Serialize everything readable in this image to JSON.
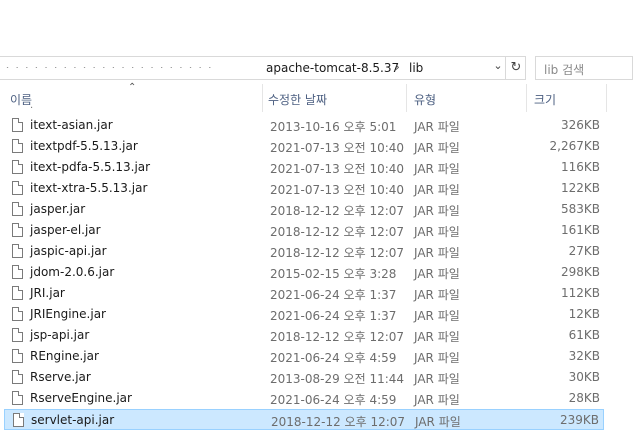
{
  "address_bar": {
    "breadcrumbs": [
      "apache-tomcat-8.5.37",
      "lib"
    ],
    "separator": "›"
  },
  "search": {
    "placeholder": "lib 검색"
  },
  "columns": {
    "name": "이름",
    "modified": "수정한 날짜",
    "type": "유형",
    "size": "크기"
  },
  "files": [
    {
      "name": "itext-asian.jar",
      "modified": "2013-10-16 오후 5:01",
      "type": "JAR 파일",
      "size": "326KB"
    },
    {
      "name": "itextpdf-5.5.13.jar",
      "modified": "2021-07-13 오전 10:40",
      "type": "JAR 파일",
      "size": "2,267KB"
    },
    {
      "name": "itext-pdfa-5.5.13.jar",
      "modified": "2021-07-13 오전 10:40",
      "type": "JAR 파일",
      "size": "116KB"
    },
    {
      "name": "itext-xtra-5.5.13.jar",
      "modified": "2021-07-13 오전 10:40",
      "type": "JAR 파일",
      "size": "122KB"
    },
    {
      "name": "jasper.jar",
      "modified": "2018-12-12 오후 12:07",
      "type": "JAR 파일",
      "size": "583KB"
    },
    {
      "name": "jasper-el.jar",
      "modified": "2018-12-12 오후 12:07",
      "type": "JAR 파일",
      "size": "161KB"
    },
    {
      "name": "jaspic-api.jar",
      "modified": "2018-12-12 오후 12:07",
      "type": "JAR 파일",
      "size": "27KB"
    },
    {
      "name": "jdom-2.0.6.jar",
      "modified": "2015-02-15 오후 3:28",
      "type": "JAR 파일",
      "size": "298KB"
    },
    {
      "name": "JRI.jar",
      "modified": "2021-06-24 오후 1:37",
      "type": "JAR 파일",
      "size": "112KB"
    },
    {
      "name": "JRIEngine.jar",
      "modified": "2021-06-24 오후 1:37",
      "type": "JAR 파일",
      "size": "12KB"
    },
    {
      "name": "jsp-api.jar",
      "modified": "2018-12-12 오후 12:07",
      "type": "JAR 파일",
      "size": "61KB"
    },
    {
      "name": "REngine.jar",
      "modified": "2021-06-24 오후 4:59",
      "type": "JAR 파일",
      "size": "32KB"
    },
    {
      "name": "Rserve.jar",
      "modified": "2013-08-29 오전 11:44",
      "type": "JAR 파일",
      "size": "30KB"
    },
    {
      "name": "RserveEngine.jar",
      "modified": "2021-06-24 오후 4:59",
      "type": "JAR 파일",
      "size": "28KB"
    },
    {
      "name": "servlet-api.jar",
      "modified": "2018-12-12 오후 12:07",
      "type": "JAR 파일",
      "size": "239KB",
      "selected": true
    }
  ],
  "colors": {
    "selected_bg": "#cce8ff",
    "selected_border": "#99d1ff",
    "header_text": "#4d6082"
  }
}
